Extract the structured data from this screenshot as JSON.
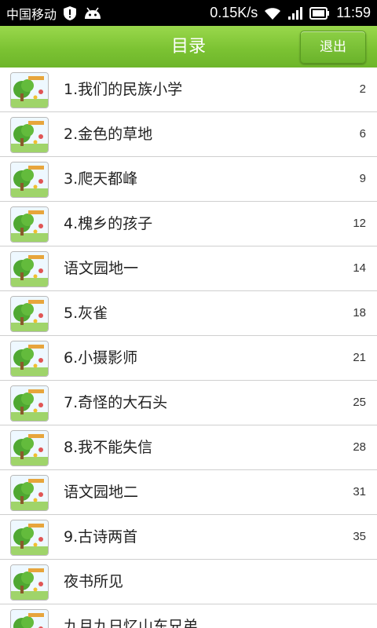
{
  "status_bar": {
    "carrier": "中国移动",
    "speed": "0.15K/s",
    "time": "11:59",
    "icons": [
      "shield-icon",
      "android-icon",
      "wifi-icon",
      "signal-icon",
      "battery-icon"
    ]
  },
  "header": {
    "title": "目录",
    "exit_label": "退出",
    "color": "#7cc333"
  },
  "list": {
    "items": [
      {
        "title": "1.我们的民族小学",
        "page": "2"
      },
      {
        "title": "2.金色的草地",
        "page": "6"
      },
      {
        "title": "3.爬天都峰",
        "page": "9"
      },
      {
        "title": "4.槐乡的孩子",
        "page": "12"
      },
      {
        "title": "语文园地一",
        "page": "14"
      },
      {
        "title": "5.灰雀",
        "page": "18"
      },
      {
        "title": "6.小摄影师",
        "page": "21"
      },
      {
        "title": "7.奇怪的大石头",
        "page": "25"
      },
      {
        "title": "8.我不能失信",
        "page": "28"
      },
      {
        "title": "语文园地二",
        "page": "31"
      },
      {
        "title": "9.古诗两首",
        "page": "35"
      },
      {
        "title": "夜书所见",
        "page": ""
      },
      {
        "title": "九月九日忆山东兄弟",
        "page": ""
      }
    ]
  }
}
